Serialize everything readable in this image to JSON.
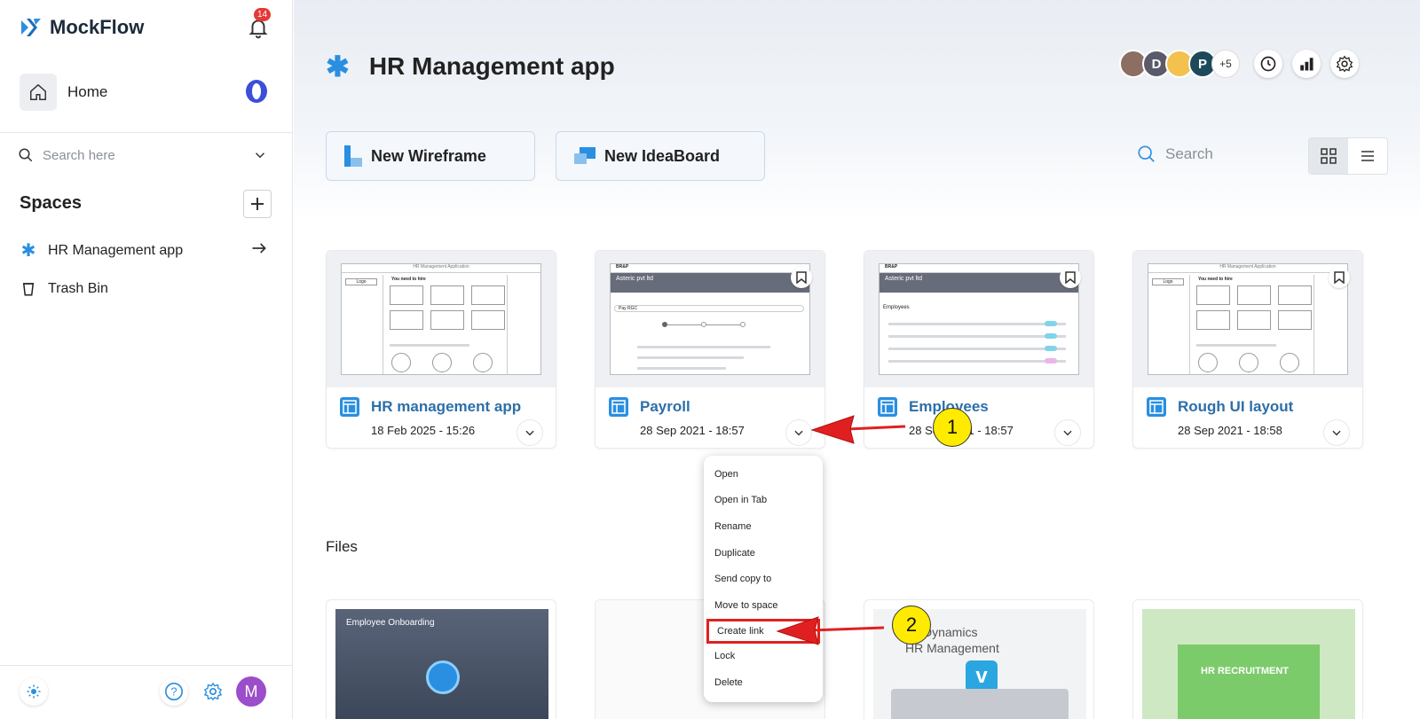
{
  "sidebar": {
    "brand": "MockFlow",
    "notification_count": "14",
    "home_label": "Home",
    "search_placeholder": "Search here",
    "spaces_title": "Spaces",
    "spaces": [
      {
        "label": "HR Management app",
        "icon": "asterisk-icon"
      },
      {
        "label": "Trash Bin",
        "icon": "trash-icon"
      }
    ],
    "user_initial": "M"
  },
  "header": {
    "title": "HR Management app",
    "collaborators": [
      "",
      "D",
      "",
      "P"
    ],
    "more_collaborators": "+5"
  },
  "actions": {
    "new_wireframe": "New Wireframe",
    "new_ideaboard": "New IdeaBoard",
    "search_placeholder": "Search"
  },
  "projects": [
    {
      "name": "HR management app",
      "date": "18 Feb 2025 - 15:26"
    },
    {
      "name": "Payroll",
      "date": "28 Sep 2021 - 18:57"
    },
    {
      "name": "Employees",
      "date": "28 Sep 2021 - 18:57"
    },
    {
      "name": "Rough UI layout",
      "date": "28 Sep 2021 - 18:58"
    }
  ],
  "thumb_text": {
    "app1": "HR Management Application",
    "need": "You need to hire",
    "logo": "Logo",
    "brand2": "BR&P",
    "company": "Asteric pvt ltd",
    "employees": "Employees",
    "payroll": "Pay RGC"
  },
  "files_title": "Files",
  "files": [
    {
      "title": "Employee Onboarding"
    },
    {
      "title": ""
    },
    {
      "title": "Dynamics HR Management",
      "line1": "Dynamics",
      "line2": "HR Management"
    },
    {
      "title": "HR RECRUITMENT"
    }
  ],
  "context_menu": {
    "items": [
      "Open",
      "Open in Tab",
      "Rename",
      "Duplicate",
      "Send copy to",
      "Move to space",
      "Create link",
      "Lock",
      "Delete"
    ],
    "highlighted": "Create link"
  },
  "annotations": {
    "marker1": "1",
    "marker2": "2"
  },
  "colors": {
    "accent": "#2a8fe0",
    "link": "#2c6fa8",
    "annotation_red": "#e02020",
    "marker_yellow": "#ffeb00"
  }
}
